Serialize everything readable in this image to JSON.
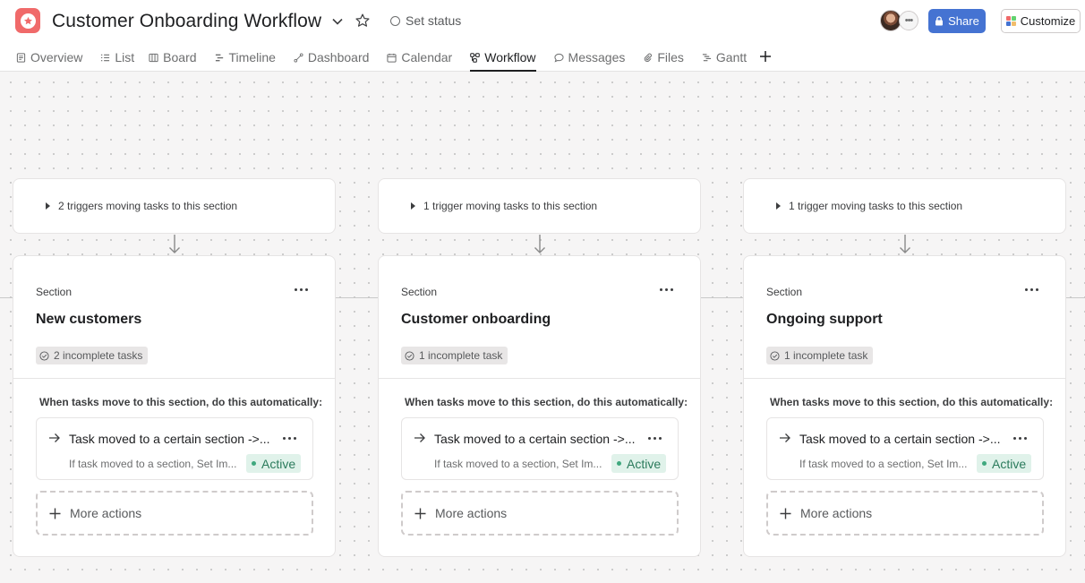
{
  "project": {
    "title": "Customer Onboarding Workflow",
    "set_status": "Set status",
    "share_label": "Share",
    "customize_label": "Customize",
    "accent_color": "#f06a6a",
    "share_color": "#4573d2"
  },
  "tabs": [
    {
      "label": "Overview",
      "icon": "overview-icon"
    },
    {
      "label": "List",
      "icon": "list-icon"
    },
    {
      "label": "Board",
      "icon": "board-icon"
    },
    {
      "label": "Timeline",
      "icon": "timeline-icon"
    },
    {
      "label": "Dashboard",
      "icon": "dashboard-icon"
    },
    {
      "label": "Calendar",
      "icon": "calendar-icon"
    },
    {
      "label": "Workflow",
      "icon": "workflow-icon",
      "active": true
    },
    {
      "label": "Messages",
      "icon": "messages-icon"
    },
    {
      "label": "Files",
      "icon": "files-icon"
    },
    {
      "label": "Gantt",
      "icon": "gantt-icon"
    }
  ],
  "sections": [
    {
      "trigger": "2 triggers moving tasks to this section",
      "kicker": "Section",
      "name": "New customers",
      "incomplete": "2 incomplete tasks",
      "auto_label": "When tasks move to this section, do this automatically:",
      "rule_title": "Task moved to a certain section ->...",
      "rule_desc": "If task moved to a section, Set Im...",
      "rule_status": "Active",
      "more_actions": "More actions"
    },
    {
      "trigger": "1 trigger moving tasks to this section",
      "kicker": "Section",
      "name": "Customer onboarding",
      "incomplete": "1 incomplete task",
      "auto_label": "When tasks move to this section, do this automatically:",
      "rule_title": "Task moved to a certain section ->...",
      "rule_desc": "If task moved to a section, Set Im...",
      "rule_status": "Active",
      "more_actions": "More actions"
    },
    {
      "trigger": "1 trigger moving tasks to this section",
      "kicker": "Section",
      "name": "Ongoing support",
      "incomplete": "1 incomplete task",
      "auto_label": "When tasks move to this section, do this automatically:",
      "rule_title": "Task moved to a certain section ->...",
      "rule_desc": "If task moved to a section, Set Im...",
      "rule_status": "Active",
      "more_actions": "More actions"
    }
  ]
}
